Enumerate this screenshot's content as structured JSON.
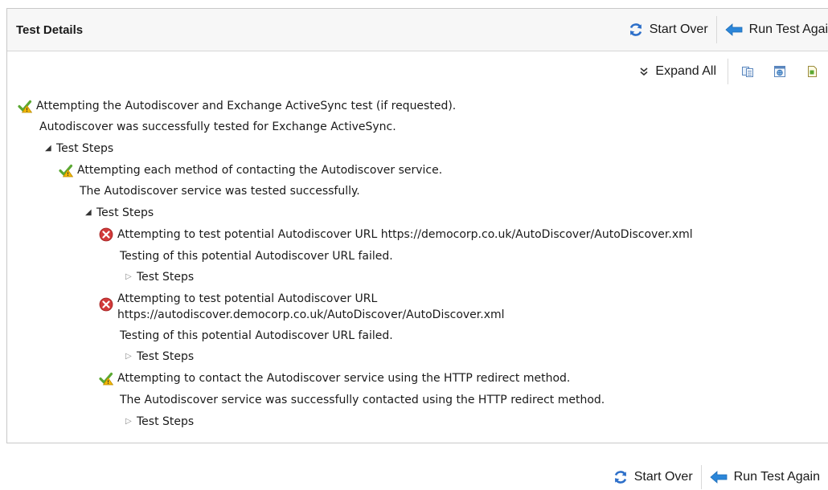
{
  "header": {
    "title": "Test Details",
    "start_over": "Start Over",
    "run_again": "Run Test Again"
  },
  "toolbar": {
    "expand_all": "Expand All"
  },
  "tree": {
    "root_title": "Attempting the Autodiscover and Exchange ActiveSync test (if requested).",
    "root_result": "Autodiscover was successfully tested for Exchange ActiveSync.",
    "root_steps": "Test Steps",
    "method_title": "Attempting each method of contacting the Autodiscover service.",
    "method_result": "The Autodiscover service was tested successfully.",
    "method_steps": "Test Steps",
    "url1_title": "Attempting to test potential Autodiscover URL https://democorp.co.uk/AutoDiscover/AutoDiscover.xml",
    "url1_result": "Testing of this potential Autodiscover URL failed.",
    "url1_steps": "Test Steps",
    "url2_title_line1": "Attempting to test potential Autodiscover URL",
    "url2_title_line2": "https://autodiscover.democorp.co.uk/AutoDiscover/AutoDiscover.xml",
    "url2_result": "Testing of this potential Autodiscover URL failed.",
    "url2_steps": "Test Steps",
    "redirect_title": "Attempting to contact the Autodiscover service using the HTTP redirect method.",
    "redirect_result": "The Autodiscover service was successfully contacted using the HTTP redirect method.",
    "redirect_steps": "Test Steps"
  },
  "footer": {
    "start_over": "Start Over",
    "run_again": "Run Test Again"
  },
  "colors": {
    "success": "#5aa832",
    "warning": "#f2b600",
    "error": "#d23a3a",
    "refresh": "#2d6fc9",
    "back_arrow": "#2b86d9"
  }
}
